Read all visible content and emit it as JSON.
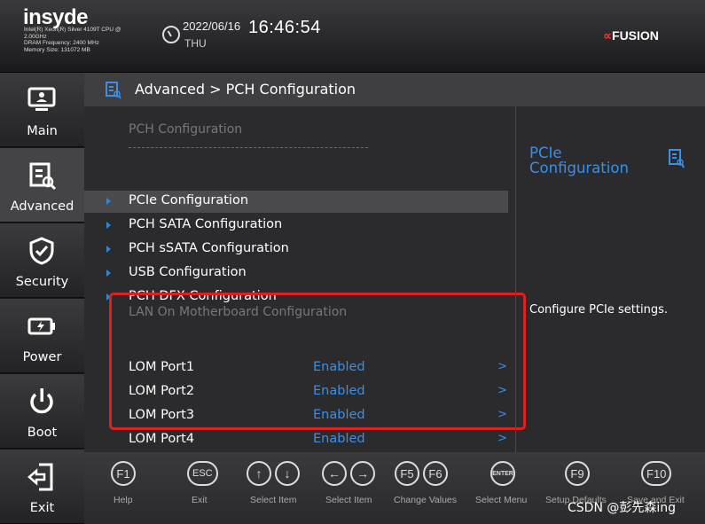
{
  "header": {
    "brand": "insyde",
    "sysinfo": [
      "Intel(R) Xeon(R) Silver 4109T CPU @",
      "2.00GHz",
      "DRAM Frequency: 2400 MHz",
      "Memory Size: 131072 MB"
    ],
    "date": "2022/06/16",
    "weekday": "THU",
    "time": "16:46:54",
    "vendor_mark": "∝",
    "vendor_name": "FUSION"
  },
  "sidebar": {
    "items": [
      {
        "label": "Main",
        "icon": "monitor-icon",
        "active": false
      },
      {
        "label": "Advanced",
        "icon": "advanced-icon",
        "active": true
      },
      {
        "label": "Security",
        "icon": "shield-icon",
        "active": false
      },
      {
        "label": "Power",
        "icon": "battery-icon",
        "active": false
      },
      {
        "label": "Boot",
        "icon": "power-icon",
        "active": false
      },
      {
        "label": "Exit",
        "icon": "exit-icon",
        "active": false
      }
    ]
  },
  "main": {
    "breadcrumb": "Advanced > PCH Configuration",
    "section_title": "PCH Configuration",
    "separator": "------------------------------------------------",
    "menu_items": [
      {
        "label": "PCIe Configuration",
        "selected": true
      },
      {
        "label": "PCH SATA Configuration",
        "selected": false
      },
      {
        "label": "PCH sSATA Configuration",
        "selected": false
      },
      {
        "label": "USB Configuration",
        "selected": false
      },
      {
        "label": "PCH DFX Configuration",
        "selected": false
      }
    ],
    "lom": {
      "title": "LAN On Motherboard Configuration",
      "rows": [
        {
          "name": "LOM Port1",
          "value": "Enabled",
          "arrow": ">"
        },
        {
          "name": "LOM Port2",
          "value": "Enabled",
          "arrow": ">"
        },
        {
          "name": "LOM Port3",
          "value": "Enabled",
          "arrow": ">"
        },
        {
          "name": "LOM Port4",
          "value": "Enabled",
          "arrow": ">"
        }
      ]
    }
  },
  "help": {
    "title": "PCIe Configuration",
    "text": "Configure PCIe settings."
  },
  "footer": {
    "keys": [
      {
        "caps": [
          "F1"
        ],
        "label": "Help"
      },
      {
        "caps": [
          "ESC"
        ],
        "label": "Exit"
      },
      {
        "caps": [
          "↑",
          "↓"
        ],
        "label": "Select Item"
      },
      {
        "caps": [
          "←",
          "→"
        ],
        "label": "Select Item"
      },
      {
        "caps": [
          "F5",
          "F6"
        ],
        "label": "Change Values"
      },
      {
        "caps": [
          "ENTER"
        ],
        "label": "Select Menu"
      },
      {
        "caps": [
          "F9"
        ],
        "label": "Setup Defaults"
      },
      {
        "caps": [
          "F10"
        ],
        "label": "Save and Exit"
      }
    ]
  },
  "watermark": "CSDN @彭先森ing",
  "colors": {
    "accent": "#3b8fe6",
    "highlight_box": "#e02020",
    "background": "#2b2b2d"
  }
}
